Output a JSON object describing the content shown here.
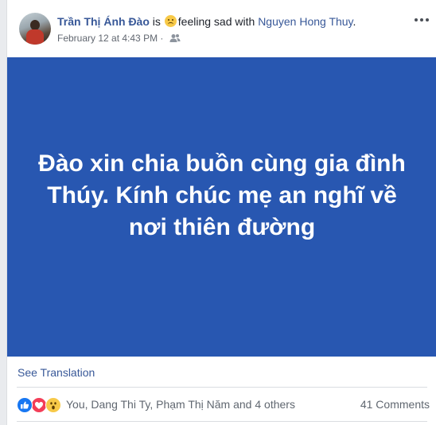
{
  "post": {
    "author": "Trần Thị Ánh Đào",
    "is_text": " is ",
    "feeling_text": "feeling sad with ",
    "tagged_user": "Nguyen Hong Thuy",
    "tagged_suffix": ".",
    "timestamp": "February 12 at 4:43 PM",
    "separator": " · ",
    "audience_icon": "friends-icon",
    "status_text": "Đào xin chia buồn cùng gia đình Thúy. Kính chúc mẹ an nghĩ về nơi thiên đường",
    "status_bg_color": "#2857b1",
    "see_translation": "See Translation"
  },
  "reactions": {
    "icons": [
      "like-reaction-icon",
      "love-reaction-icon",
      "wow-reaction-icon"
    ],
    "names": "You, Dang Thi Ty, Phạm Thị Năm and 4 others",
    "comments": "41 Comments"
  },
  "colors": {
    "link": "#385898",
    "status_background": "#2857b1"
  }
}
